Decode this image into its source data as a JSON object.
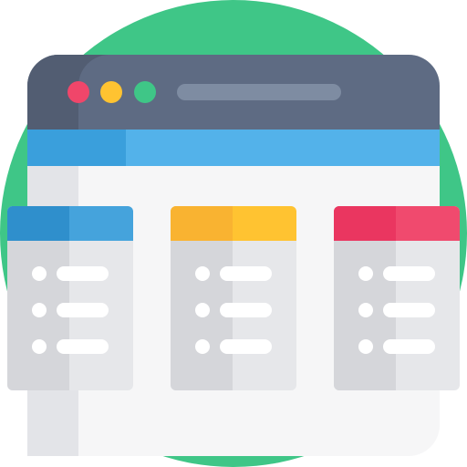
{
  "illustration": {
    "subject": "browser-window-with-three-list-cards",
    "colors": {
      "circle": "#3fc687",
      "inner_circle": "#f4f5f7",
      "titlebar": "#5e6b83",
      "titlebar_shadow": "#525d72",
      "address_bar": "#7e8ca2",
      "window_body": "#f6f6f7",
      "window_body_shadow": "#e3e4e8",
      "nav_band": "#53b2ea",
      "nav_band_shadow": "#3a9fdc",
      "dot_close": "#f0466a",
      "dot_minimize": "#ffc331",
      "dot_maximize": "#3fc687",
      "card_body": "#e6e7ea",
      "card_body_shadow": "#d5d6da",
      "list_item": "#ffffff",
      "card_header_blue": "#45a3dc",
      "card_header_blue_shadow": "#2f8fcc",
      "card_header_yellow": "#ffc331",
      "card_header_yellow_shadow": "#f9b331",
      "card_header_red": "#f04a6e",
      "card_header_red_shadow": "#ea3660"
    },
    "window_controls": [
      {
        "name": "close-dot",
        "color": "#f0466a"
      },
      {
        "name": "minimize-dot",
        "color": "#ffc331"
      },
      {
        "name": "maximize-dot",
        "color": "#3fc687"
      }
    ],
    "cards": [
      {
        "name": "card-blue",
        "header": "#45a3dc",
        "header_shadow": "#2f8fcc",
        "items": 3
      },
      {
        "name": "card-yellow",
        "header": "#ffc331",
        "header_shadow": "#f9b331",
        "items": 3
      },
      {
        "name": "card-red",
        "header": "#f04a6e",
        "header_shadow": "#ea3660",
        "items": 3
      }
    ]
  }
}
